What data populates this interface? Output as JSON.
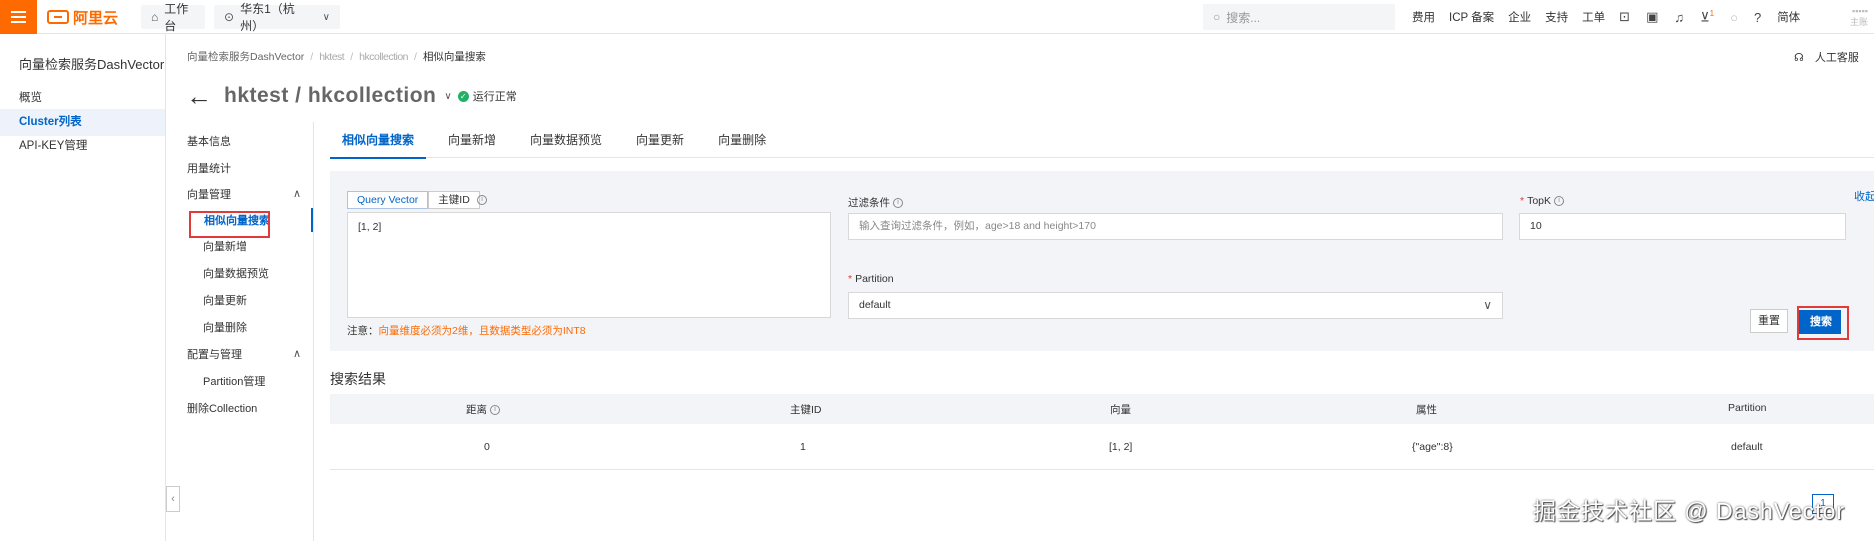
{
  "topbar": {
    "logo_text": "阿里云",
    "workbench": "工作台",
    "region": "华东1（杭州）",
    "search_placeholder": "搜索...",
    "nav": [
      "费用",
      "ICP 备案",
      "企业",
      "支持",
      "工单"
    ],
    "cart_badge": "1",
    "lang": "简体",
    "user_partial": "主账"
  },
  "sidebar": {
    "title": "向量检索服务DashVector",
    "items": [
      {
        "label": "概览"
      },
      {
        "label": "Cluster列表"
      },
      {
        "label": "API-KEY管理"
      }
    ]
  },
  "breadcrumb": {
    "root": "向量检索服务DashVector",
    "cluster": "hktest",
    "collection": "hkcollection",
    "current": "相似向量搜索"
  },
  "header_right": {
    "support": "人工客服",
    "help": "帮"
  },
  "heading": {
    "title": "hktest / hkcollection",
    "status": "运行正常"
  },
  "subnav": {
    "basic": "基本信息",
    "usage": "用量统计",
    "vector_mgmt": "向量管理",
    "vector_children": [
      "相似向量搜索",
      "向量新增",
      "向量数据预览",
      "向量更新",
      "向量删除"
    ],
    "config_mgmt": "配置与管理",
    "partition_mgmt": "Partition管理",
    "delete_collection": "删除Collection"
  },
  "tabs": [
    "相似向量搜索",
    "向量新增",
    "向量数据预览",
    "向量更新",
    "向量删除"
  ],
  "form": {
    "mode_vector": "Query Vector",
    "mode_id": "主键ID",
    "vector_value": "[1, 2]",
    "note_prefix": "注意：",
    "note_warn": "向量维度必须为2维，且数据类型必须为INT8",
    "filter_label": "过滤条件",
    "filter_placeholder": "输入查询过滤条件，例如，age>18 and height>170",
    "topk_label": "TopK",
    "topk_value": "10",
    "partition_label": "Partition",
    "partition_value": "default",
    "collapse": "收起",
    "reset": "重置",
    "search": "搜索"
  },
  "results": {
    "title": "搜索结果",
    "columns": [
      "距离",
      "主键ID",
      "向量",
      "属性",
      "Partition"
    ],
    "rows": [
      [
        "0",
        "1",
        "[1, 2]",
        "{\"age\":8}",
        "default"
      ]
    ],
    "page": "1"
  },
  "watermark": "掘金技术社区 @ DashVector"
}
